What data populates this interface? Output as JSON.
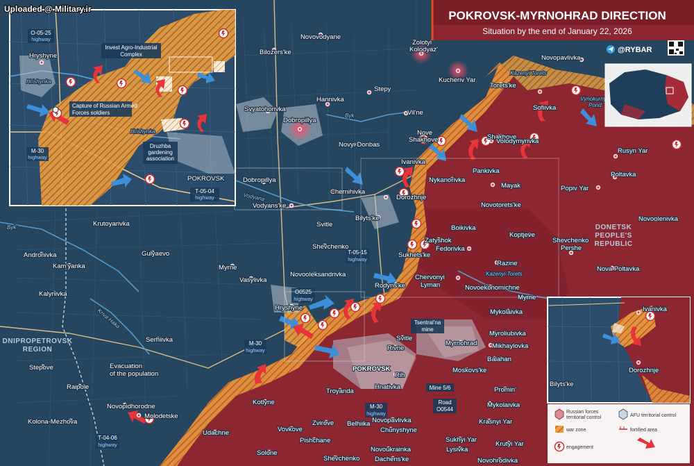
{
  "watermark": "Uploaded @ Military.ir",
  "header": {
    "title": "POKROVSK-MYRNOHRAD DIRECTION",
    "subtitle": "Situation by the end of January 22, 2026",
    "brand": "@RYBAR"
  },
  "regions": {
    "donetsk": [
      "DONETSK",
      "PEOPLE'S",
      "REPUBLIC"
    ],
    "dnipro": [
      "DNIPROPETROVSK",
      "REGION"
    ]
  },
  "rivers": [
    "Byk",
    "Vodyana",
    "Kriva Haka",
    "Byk",
    "Kazenyi Torets",
    "Kazenyi Torets",
    "Hrishynka",
    "Hrishynka"
  ],
  "ponds": [
    "Vynokurnyi",
    "Pond"
  ],
  "towns": [
    {
      "id": "novovodyane",
      "name": "Novovodyane"
    },
    {
      "id": "bilozerske",
      "name": "Bilozers'ke"
    },
    {
      "id": "zolotyi",
      "name": "Zolotyi"
    },
    {
      "id": "zolotyi2",
      "name": "Kolodyaz'"
    },
    {
      "id": "kucheriv",
      "name": "Kucheriv Yar"
    },
    {
      "id": "novopavlivka_n",
      "name": "Novopavlivka"
    },
    {
      "id": "toretske",
      "name": "Torets'ke"
    },
    {
      "id": "sofiivka",
      "name": "Sofiivka"
    },
    {
      "id": "hannivka",
      "name": "Hannivka"
    },
    {
      "id": "stepy",
      "name": "Stepy"
    },
    {
      "id": "svyatohorivka",
      "name": "Svyatohorivka"
    },
    {
      "id": "dobropillya",
      "name": "Dobropillya"
    },
    {
      "id": "vilne",
      "name": "Vil'ne"
    },
    {
      "id": "nove",
      "name": "Nove"
    },
    {
      "id": "shakhove",
      "name": "Shakhove"
    },
    {
      "id": "shakhove2",
      "name": "Shakhove"
    },
    {
      "id": "novyidonbas",
      "name": "Novyi Donbas"
    },
    {
      "id": "ivanivka",
      "name": "Ivanivka"
    },
    {
      "id": "volodymyrivka",
      "name": "Volodymyrivka"
    },
    {
      "id": "rusynyar",
      "name": "Rusyn Yar"
    },
    {
      "id": "pankivka",
      "name": "Pankivka"
    },
    {
      "id": "poltavka",
      "name": "Poltavka"
    },
    {
      "id": "nykanorivka",
      "name": "Nykanorivka"
    },
    {
      "id": "mayak",
      "name": "Mayak"
    },
    {
      "id": "popivyar",
      "name": "Popiv Yar"
    },
    {
      "id": "dobropillya2",
      "name": "Dobropillya"
    },
    {
      "id": "chernihivka",
      "name": "Chernihivka"
    },
    {
      "id": "dorozhnje",
      "name": "Dorozhnje"
    },
    {
      "id": "novotoretske",
      "name": "Novotorets'ke"
    },
    {
      "id": "vodyanske",
      "name": "Vodyans'ke"
    },
    {
      "id": "bilytske",
      "name": "Bilyts'ke"
    },
    {
      "id": "boikivka",
      "name": "Boikivka"
    },
    {
      "id": "novoolenivka",
      "name": "Novoolenivka"
    },
    {
      "id": "krutoyarivka",
      "name": "Krutoyarivka"
    },
    {
      "id": "svitle",
      "name": "Svitle"
    },
    {
      "id": "zatyshok",
      "name": "Zatyshok"
    },
    {
      "id": "koptjeve",
      "name": "Koptjeve"
    },
    {
      "id": "fedorivka",
      "name": "Fedorivka"
    },
    {
      "id": "shevchenko_p",
      "name": "Shevchenko"
    },
    {
      "id": "shevchenko_p2",
      "name": "Pershe"
    },
    {
      "id": "shevchenko",
      "name": "Shevchenko"
    },
    {
      "id": "andronivka",
      "name": "Andronivka"
    },
    {
      "id": "gulyaevo",
      "name": "Gulyaevo"
    },
    {
      "id": "sukhetske",
      "name": "Sukhets'ke"
    },
    {
      "id": "razine",
      "name": "Razine"
    },
    {
      "id": "kamyanka",
      "name": "Kam'yanka"
    },
    {
      "id": "myrne",
      "name": "Myrne"
    },
    {
      "id": "novapoltavka",
      "name": "Nova Poltavka"
    },
    {
      "id": "vasylivka",
      "name": "Vasylivka"
    },
    {
      "id": "novooleksandrivka",
      "name": "Novooleksandrivka"
    },
    {
      "id": "rodynske",
      "name": "Rodyns'ke"
    },
    {
      "id": "chervonyi",
      "name": "Chervonyi"
    },
    {
      "id": "chervonyi2",
      "name": "Lyman"
    },
    {
      "id": "novoekonomichne",
      "name": "Novoekonomichne"
    },
    {
      "id": "kalynivka",
      "name": "Kalynivka"
    },
    {
      "id": "myrne2",
      "name": "Myrne"
    },
    {
      "id": "hryshyne",
      "name": "Hryshyne"
    },
    {
      "id": "mykolaivka",
      "name": "Mykolaivka"
    },
    {
      "id": "svitle2",
      "name": "Svitle"
    },
    {
      "id": "myrnohrad",
      "name": "Myrnohrad"
    },
    {
      "id": "myroliubivka",
      "name": "Myroliubivka"
    },
    {
      "id": "serhiivka",
      "name": "Serhiivka"
    },
    {
      "id": "rivne",
      "name": "Rivne"
    },
    {
      "id": "mikhaylovka",
      "name": "Mikhaylovka"
    },
    {
      "id": "pokrovsk",
      "name": "POKROVSK"
    },
    {
      "id": "balahan",
      "name": "Balahan"
    },
    {
      "id": "stepove",
      "name": "Stepove"
    },
    {
      "id": "rih",
      "name": "Rih"
    },
    {
      "id": "moskovske",
      "name": "Moskovs'ke"
    },
    {
      "id": "hnativka",
      "name": "Hnativka"
    },
    {
      "id": "raipole",
      "name": "Raipole"
    },
    {
      "id": "troyanda",
      "name": "Troyanda"
    },
    {
      "id": "promin",
      "name": "Promin'"
    },
    {
      "id": "kotlyne",
      "name": "Kotlyne"
    },
    {
      "id": "mykolaivka2",
      "name": "Mykolaivka"
    },
    {
      "id": "novopidhorodne",
      "name": "Novopidhorodne"
    },
    {
      "id": "molodetske",
      "name": "Molodetske"
    },
    {
      "id": "novopavlivka",
      "name": "Novopavlivka"
    },
    {
      "id": "kolona",
      "name": "Kolona-Mezhova"
    },
    {
      "id": "krasnyiyar",
      "name": "Krasnyi Yar"
    },
    {
      "id": "zvirove",
      "name": "Zvirove"
    },
    {
      "id": "belhiika",
      "name": "Belhiika"
    },
    {
      "id": "vovkove",
      "name": "Vovkove"
    },
    {
      "id": "chunyshyne",
      "name": "Chunyshyne"
    },
    {
      "id": "udachne",
      "name": "Udachne"
    },
    {
      "id": "sukhiiyar",
      "name": "Sukhyi Yar"
    },
    {
      "id": "pishchane",
      "name": "Pishchane"
    },
    {
      "id": "krutyiyar",
      "name": "Krutyi Yar"
    },
    {
      "id": "novoukrainka",
      "name": "Novoukrainka"
    },
    {
      "id": "solone",
      "name": "Solone"
    },
    {
      "id": "lysivka",
      "name": "Lysivka"
    },
    {
      "id": "shevchenko_s",
      "name": "Shevchenko"
    },
    {
      "id": "dachenske",
      "name": "Dachens'ke"
    },
    {
      "id": "novohrodivka",
      "name": "Novohrodivka"
    }
  ],
  "road_labels": [
    {
      "id": "t0515",
      "code": "T-05-15",
      "type": "highway"
    },
    {
      "id": "o0525",
      "code": "O0525",
      "type": "highway"
    },
    {
      "id": "m30",
      "code": "M-30",
      "type": "highway"
    },
    {
      "id": "m30b",
      "code": "M-30",
      "type": "highway"
    },
    {
      "id": "t0406",
      "code": "T-04-06",
      "type": "highway"
    }
  ],
  "mine_labels": [
    {
      "id": "tsentralna",
      "lines": [
        "Tsentral'na",
        "mine"
      ]
    },
    {
      "id": "mine56",
      "lines": [
        "Mine 5/6"
      ]
    },
    {
      "id": "road0544",
      "lines": [
        "Road",
        "O0544"
      ]
    }
  ],
  "annotations": {
    "evacuation": [
      "Evacuation",
      "of the population"
    ]
  },
  "inset_nw": {
    "roads": [
      {
        "id": "o0525",
        "code": "O-05-25",
        "type": "highway"
      },
      {
        "id": "m30",
        "code": "M-30",
        "type": "highway"
      },
      {
        "id": "t0504",
        "code": "T-05-04",
        "type": "highway"
      }
    ],
    "towns": {
      "hryshyne": "Hryshyne",
      "pokrovsk": "POKROVSK"
    },
    "callouts": {
      "agro": [
        "Invest Agro-Industrial",
        "Complex"
      ],
      "capture": [
        "Capture of Russian Armed",
        "Forces soldiers"
      ],
      "druzhba": [
        "Druzhba",
        "gardening",
        "association"
      ]
    }
  },
  "inset_se": {
    "towns": {
      "ivanivka": "Ivanivka",
      "dorozhnje": "Dorozhnje",
      "bilytske": "Bilyts'ke"
    }
  },
  "legend": {
    "russian": [
      "Russian forces",
      "territorial control"
    ],
    "afu": "AFU territorial control",
    "warzone": "war zone",
    "fortified": "fortified area",
    "engagement": "engagement"
  },
  "colors": {
    "russian": "#8c2630",
    "afu": "#2a4a6b",
    "warzone": "#e8a23c",
    "accent": "#e84a1c",
    "header": "#7a1f28"
  }
}
